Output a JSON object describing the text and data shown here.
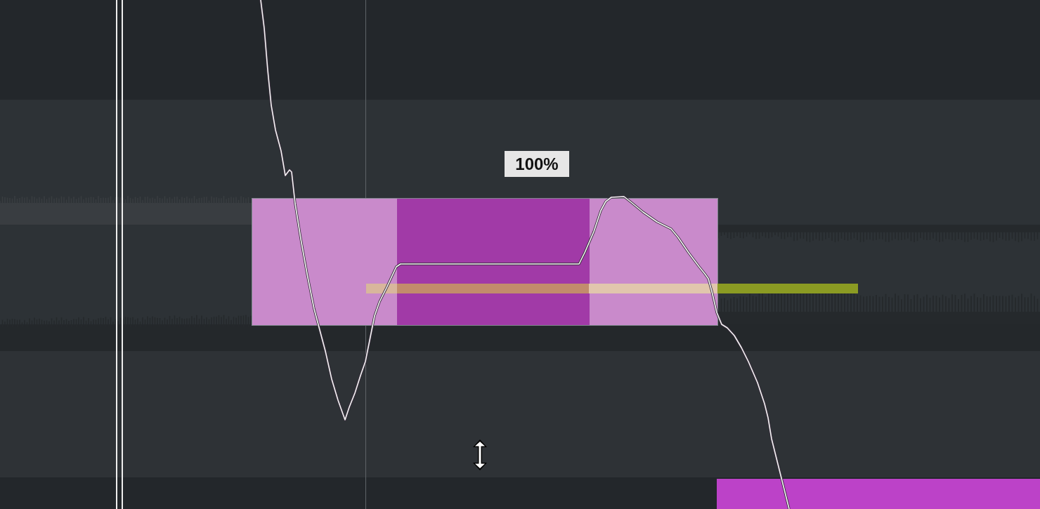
{
  "pitch_editor": {
    "value_label": "100%"
  }
}
